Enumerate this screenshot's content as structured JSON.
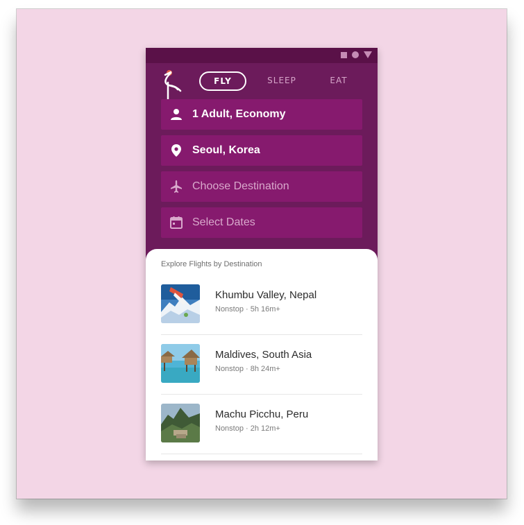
{
  "tabs": {
    "fly": "FLY",
    "sleep": "SLEEP",
    "eat": "EAT"
  },
  "fields": {
    "passengers": {
      "icon": "person-icon",
      "value": "1 Adult, Economy"
    },
    "origin": {
      "icon": "location-pin-icon",
      "value": "Seoul, Korea"
    },
    "destination": {
      "icon": "airplane-icon",
      "placeholder": "Choose Destination"
    },
    "dates": {
      "icon": "calendar-icon",
      "placeholder": "Select Dates"
    }
  },
  "explore": {
    "title": "Explore Flights by Destination",
    "items": [
      {
        "name": "Khumbu Valley, Nepal",
        "detail": "Nonstop · 5h 16m+"
      },
      {
        "name": "Maldives, South Asia",
        "detail": "Nonstop · 8h 24m+"
      },
      {
        "name": "Machu Picchu, Peru",
        "detail": "Nonstop · 2h 12m+"
      }
    ]
  },
  "colors": {
    "page_background": "#f3d6e6",
    "header": "#6c1b5b",
    "status_bar": "#5a1148",
    "field": "#861a6e",
    "logo_accent": "#e2614a"
  }
}
